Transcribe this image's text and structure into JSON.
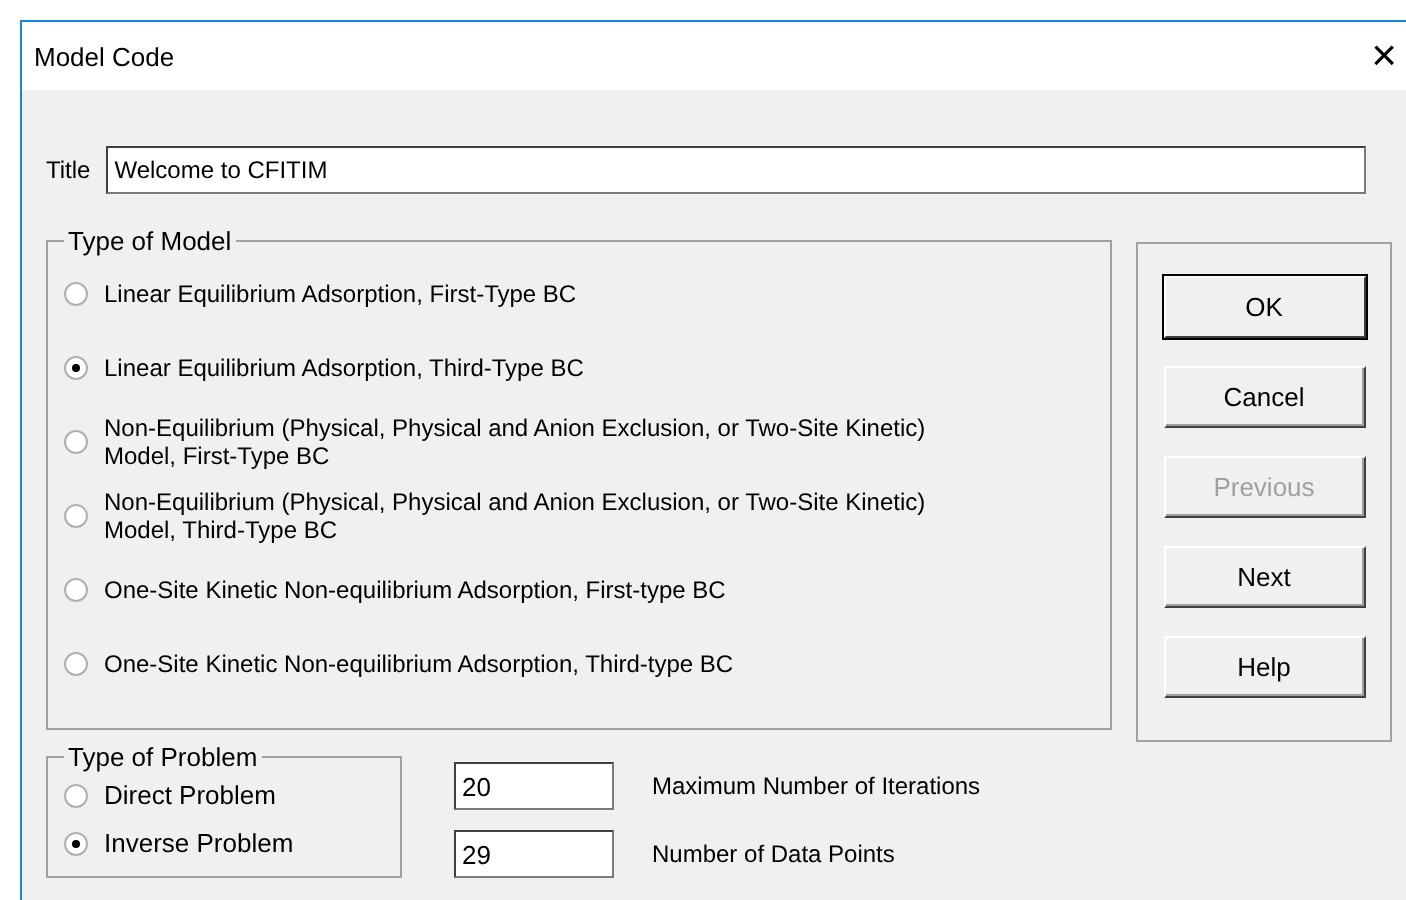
{
  "window": {
    "title": "Model Code",
    "close": "×"
  },
  "title_field": {
    "label": "Title",
    "value": "Welcome to CFITIM"
  },
  "type_of_model": {
    "legend": "Type of Model",
    "options": [
      {
        "label": "Linear Equilibrium Adsorption, First-Type BC",
        "selected": false
      },
      {
        "label": "Linear Equilibrium Adsorption, Third-Type BC",
        "selected": true
      },
      {
        "label": "Non-Equilibrium (Physical, Physical and Anion Exclusion, or Two-Site Kinetic) Model, First-Type BC",
        "selected": false
      },
      {
        "label": "Non-Equilibrium (Physical, Physical and Anion Exclusion, or Two-Site Kinetic) Model, Third-Type BC",
        "selected": false
      },
      {
        "label": "One-Site Kinetic Non-equilibrium Adsorption, First-type BC",
        "selected": false
      },
      {
        "label": "One-Site Kinetic Non-equilibrium Adsorption, Third-type BC",
        "selected": false
      }
    ]
  },
  "buttons": [
    {
      "label": "OK",
      "disabled": false,
      "default": true
    },
    {
      "label": "Cancel",
      "disabled": false,
      "default": false
    },
    {
      "label": "Previous",
      "disabled": true,
      "default": false
    },
    {
      "label": "Next",
      "disabled": false,
      "default": false
    },
    {
      "label": "Help",
      "disabled": false,
      "default": false
    }
  ],
  "type_of_problem": {
    "legend": "Type of Problem",
    "options": [
      {
        "label": "Direct Problem",
        "selected": false
      },
      {
        "label": "Inverse Problem",
        "selected": true
      }
    ]
  },
  "fields": [
    {
      "value": "20",
      "label": "Maximum Number of Iterations"
    },
    {
      "value": "29",
      "label": "Number of Data Points"
    }
  ]
}
